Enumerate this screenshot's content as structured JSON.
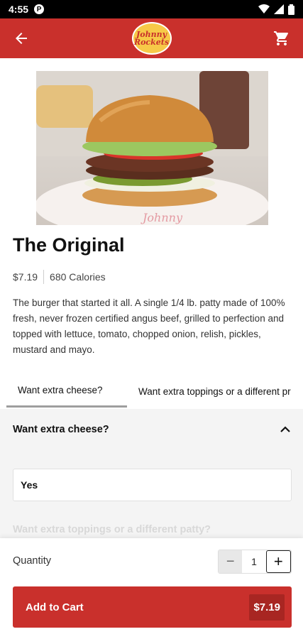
{
  "status_bar": {
    "time": "4:55",
    "app_badge": "P"
  },
  "app_bar": {
    "logo_text": "Johnny Rockets"
  },
  "product": {
    "name": "The Original",
    "price": "$7.19",
    "calories": "680 Calories",
    "description": "The burger that started it all. A single 1/4 lb. patty made of 100% fresh, never frozen certified angus beef, grilled to perfection and topped with lettuce, tomato, chopped onion, relish, pickles, mustard and mayo.",
    "image_plate_text": "Johnny"
  },
  "tabs": [
    {
      "label": "Want extra cheese?"
    },
    {
      "label": "Want extra toppings or a different pr"
    }
  ],
  "section": {
    "title": "Want extra cheese?",
    "options": [
      {
        "label": "Yes"
      }
    ],
    "next_title": "Want extra toppings or a different patty?"
  },
  "cart": {
    "quantity_label": "Quantity",
    "quantity_value": "1",
    "minus": "−",
    "plus": "+",
    "add_label": "Add to Cart",
    "add_price": "$7.19"
  },
  "colors": {
    "brand_red": "#c9302c",
    "brand_red_dark": "#a82622"
  }
}
